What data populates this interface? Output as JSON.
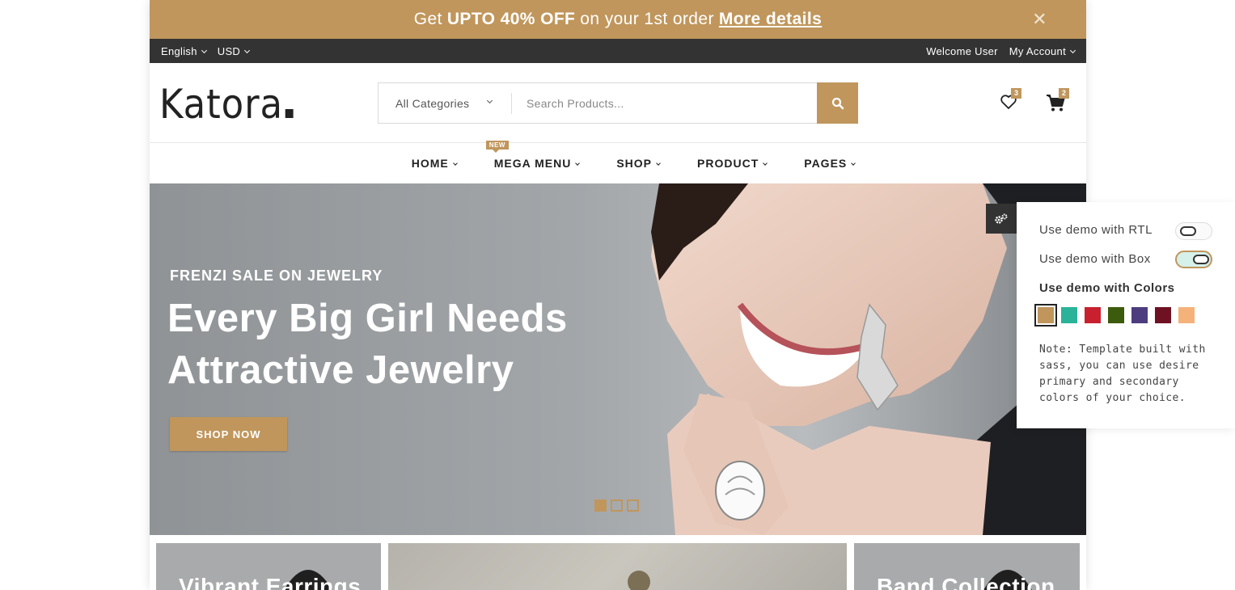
{
  "promo": {
    "prefix": "Get",
    "highlight": "UPTO 40% OFF",
    "suffix": "on your 1st order",
    "link": "More details",
    "close": "✕"
  },
  "topbar": {
    "language": "English",
    "currency": "USD",
    "welcome": "Welcome User",
    "account": "My Account"
  },
  "header": {
    "logo": "Katora",
    "category": "All Categories",
    "search_placeholder": "Search Products...",
    "wishlist_count": "3",
    "cart_count": "2"
  },
  "nav": {
    "items": [
      "HOME",
      "MEGA MENU",
      "SHOP",
      "PRODUCT",
      "PAGES"
    ],
    "new_tag": "NEW"
  },
  "hero": {
    "subtitle": "FRENZI SALE ON JEWELRY",
    "title": "Every Big Girl Needs Attractive Jewelry",
    "button": "SHOP NOW",
    "slides": 3,
    "active_slide": 1
  },
  "banners": [
    "Vibrant Earrings",
    "Band Collection"
  ],
  "settings": {
    "rtl_label": "Use demo with RTL",
    "rtl_on": false,
    "box_label": "Use demo with Box",
    "box_on": true,
    "colors_label": "Use demo with Colors",
    "colors": [
      "#c0965c",
      "#2bb39a",
      "#c8202f",
      "#3d5b0d",
      "#4d3d7f",
      "#6e1223",
      "#f4b27a"
    ],
    "selected_color": "#c0965c",
    "note": "Note: Template built with sass, you can use desire primary and secondary colors of your choice."
  },
  "theme": {
    "accent": "#c0965c",
    "dark": "#333333"
  }
}
